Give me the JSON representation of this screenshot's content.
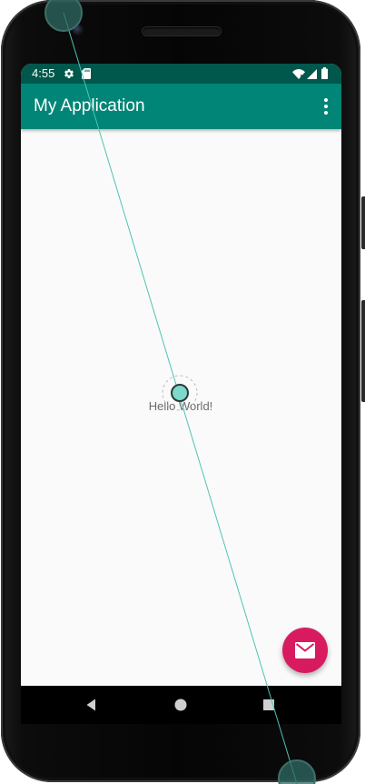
{
  "status_bar": {
    "time": "4:55",
    "icons": [
      "gear-icon",
      "sd-card-icon",
      "wifi-icon",
      "signal-icon",
      "battery-icon"
    ]
  },
  "app_bar": {
    "title": "My Application",
    "overflow_icon": "more-vert-icon"
  },
  "content": {
    "text": "Hello World!"
  },
  "fab": {
    "icon": "email-icon"
  },
  "nav_bar": {
    "buttons": [
      "back-icon",
      "home-icon",
      "recents-icon"
    ]
  },
  "colors": {
    "status_bar": "#00574b",
    "app_bar": "#008577",
    "fab": "#d81b60",
    "background": "#fafafa",
    "constraint_line": "#4fc3b5"
  }
}
